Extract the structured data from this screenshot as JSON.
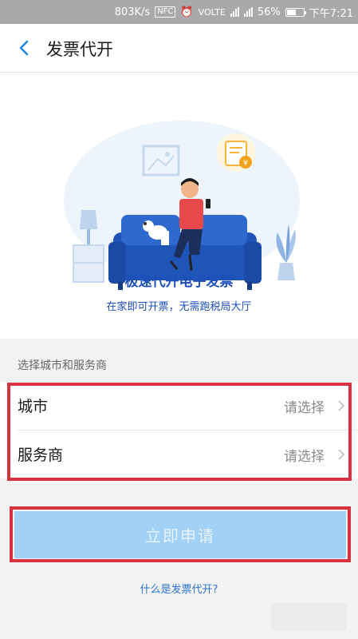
{
  "status_bar": {
    "speed": "803K/s",
    "nfc": "NFC",
    "volte": "VOLTE",
    "battery_percent": "56%",
    "battery_level": 0.56,
    "time": "下午7:21"
  },
  "nav": {
    "title": "发票代开",
    "back_icon": "chevron-left-icon"
  },
  "hero": {
    "title": "极速代开电子发票",
    "subtitle": "在家即可开票，无需跑税局大厅"
  },
  "form": {
    "section_label": "选择城市和服务商",
    "rows": [
      {
        "label": "城市",
        "value": "请选择"
      },
      {
        "label": "服务商",
        "value": "请选择"
      }
    ]
  },
  "apply_button": {
    "label": "立即申请"
  },
  "help_link": {
    "label": "什么是发票代开?"
  },
  "colors": {
    "accent_blue": "#1d4fb8",
    "button_disabled": "#a3d1f6",
    "highlight_red": "#d6323f"
  }
}
